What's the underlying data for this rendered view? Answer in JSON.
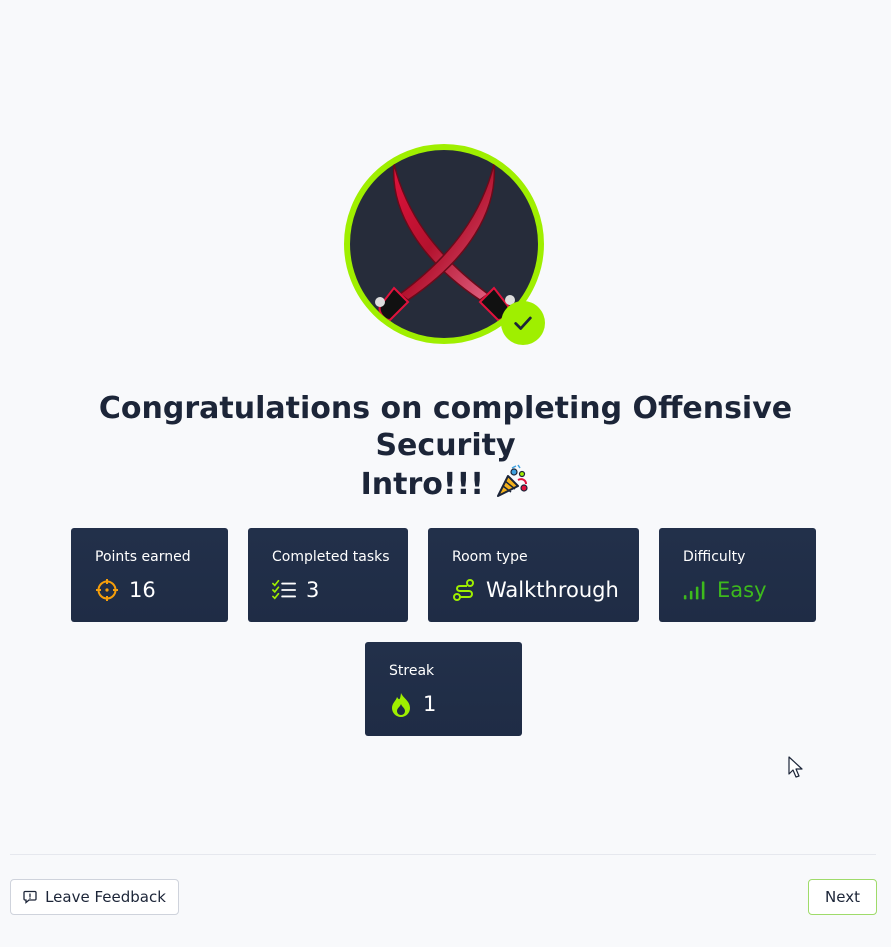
{
  "badge": {
    "alt": "Offensive Security Intro badge",
    "ring_color": "#9fef00",
    "icon": "crossed-swords-icon"
  },
  "completed_check_icon": "checkmark-icon",
  "heading": {
    "line1": "Congratulations on completing Offensive Security",
    "line2": "Intro!!!",
    "emoji": "party-popper-icon"
  },
  "stats": {
    "points": {
      "label": "Points earned",
      "value": "16",
      "icon": "crosshair-icon",
      "icon_color": "#f59e0b"
    },
    "tasks": {
      "label": "Completed tasks",
      "value": "3",
      "icon": "checklist-icon",
      "icon_color": "#9fef00"
    },
    "room_type": {
      "label": "Room type",
      "value": "Walkthrough",
      "icon": "route-icon",
      "icon_color": "#9fef00"
    },
    "difficulty": {
      "label": "Difficulty",
      "value": "Easy",
      "icon": "signal-bars-icon",
      "value_color": "#3dba1c"
    },
    "streak": {
      "label": "Streak",
      "value": "1",
      "icon": "flame-icon",
      "icon_color": "#9fef00"
    }
  },
  "footer": {
    "feedback_label": "Leave Feedback",
    "feedback_icon": "message-icon",
    "next_label": "Next"
  }
}
